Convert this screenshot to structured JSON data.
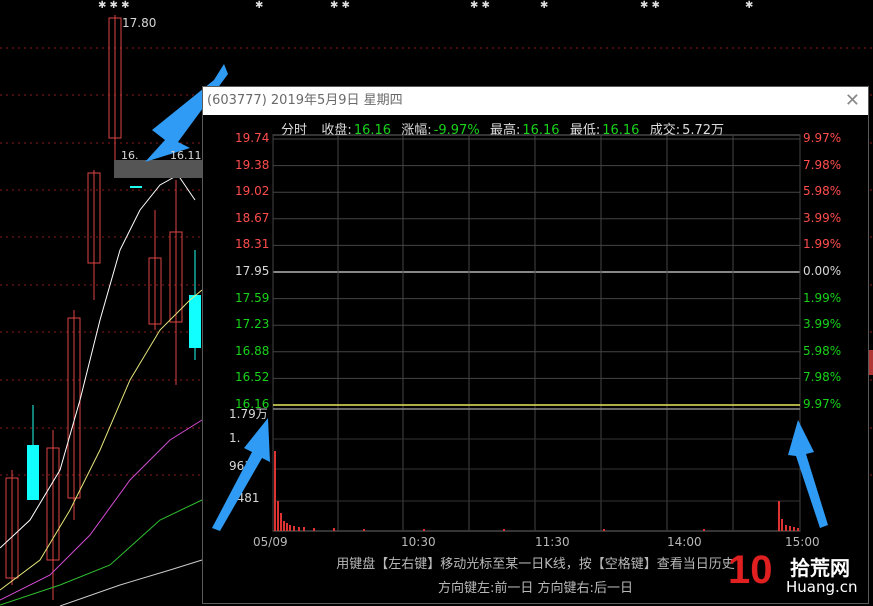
{
  "background_chart": {
    "high_label": "17.80",
    "left_label_a": "16.",
    "left_label_b": "16.11"
  },
  "popup": {
    "title": "(603777) 2019年5月9日 星期四",
    "info": {
      "mode": "分时",
      "close_label": "收盘:",
      "close_value": "16.16",
      "change_label": "涨幅:",
      "change_value": "-9.97%",
      "high_label": "最高:",
      "high_value": "16.16",
      "low_label": "最低:",
      "low_value": "16.16",
      "volume_label": "成交:",
      "volume_value": "5.72万"
    },
    "y_left": [
      "19.74",
      "19.38",
      "19.02",
      "18.67",
      "18.31",
      "17.95",
      "17.59",
      "17.23",
      "16.88",
      "16.52",
      "16.16"
    ],
    "y_right": [
      "9.97%",
      "7.98%",
      "5.98%",
      "3.99%",
      "1.99%",
      "0.00%",
      "1.99%",
      "3.99%",
      "5.98%",
      "7.98%",
      "9.97%"
    ],
    "volume_labels": [
      "1.79万",
      "1.",
      "961",
      "4481"
    ],
    "x_labels": [
      "05/09",
      "10:30",
      "11:30",
      "14:00",
      "15:00"
    ],
    "footer_line1": "用键盘【左右键】移动光标至某一日K线，按【空格键】查看当日历史",
    "footer_line2": "方向键左:前一日    方向键右:后一日"
  },
  "watermark": {
    "num": "10",
    "text1": "拾荒网",
    "text2": "Huang.cn"
  },
  "colors": {
    "red": "#ff4d4d",
    "green": "#19d219",
    "arrow": "#2f9bf5",
    "price_line": "#e8e85a"
  }
}
